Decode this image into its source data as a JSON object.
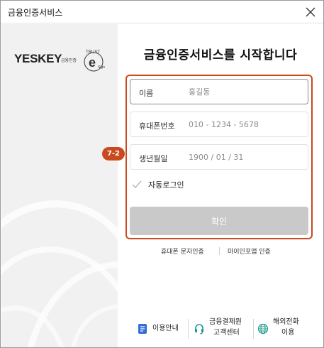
{
  "window": {
    "title": "금융인증서비스",
    "close_icon": "close-icon"
  },
  "brand": {
    "logo_text": "YESKEY",
    "logo_sub": "금융인증",
    "badge_top": "TRUST",
    "badge_letter": "e",
    "badge_bottom": "Sign"
  },
  "heading": "금융인증서비스를 시작합니다",
  "annotation": {
    "step_badge": "7-2",
    "highlight_color": "#c84a1e"
  },
  "form": {
    "name": {
      "label": "이름",
      "placeholder": "홍길동"
    },
    "phone": {
      "label": "휴대폰번호",
      "placeholder": "010 - 1234 - 5678"
    },
    "birth": {
      "label": "생년월일",
      "placeholder": "1900 / 01 / 31"
    },
    "auto_login": {
      "label": "자동로그인",
      "checked": false
    },
    "confirm_label": "확인"
  },
  "alt_auth": {
    "sms_label": "휴대폰 문자인증",
    "mydata_label": "마이인포앱 인증"
  },
  "footer": {
    "guide": {
      "label": "이용안내",
      "icon": "document-icon"
    },
    "support": {
      "line1": "금융결제원",
      "line2": "고객센터",
      "icon": "headset-icon"
    },
    "overseas": {
      "line1": "해외전화",
      "line2": "이용",
      "icon": "globe-icon"
    }
  },
  "colors": {
    "accent": "#c84a1e",
    "button_disabled": "#c9c9c9",
    "left_panel": "#f1f1f1",
    "icon_blue": "#2f6fd6",
    "icon_green": "#1a9a8a"
  }
}
